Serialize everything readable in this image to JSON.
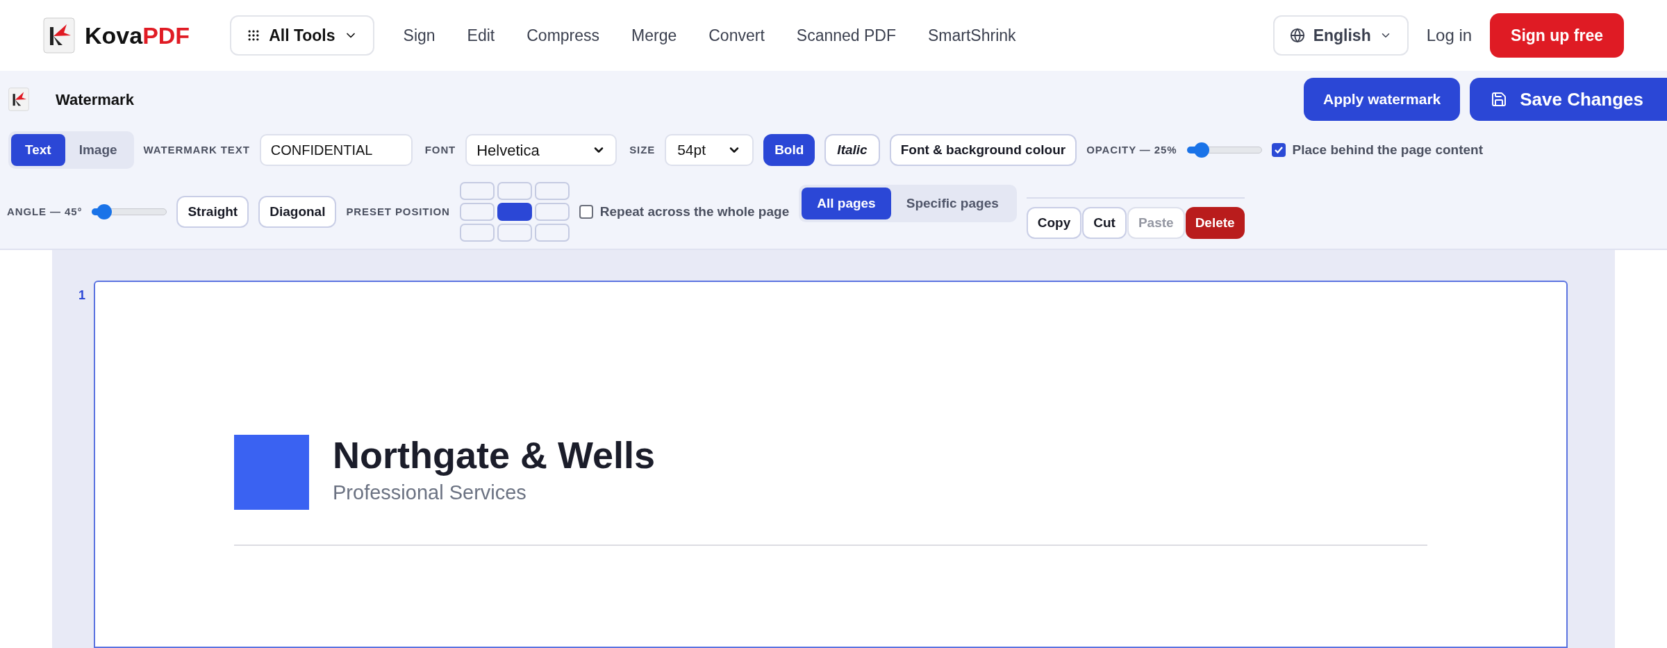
{
  "header": {
    "brand": {
      "part_1": "Kova",
      "part_2": "PDF"
    },
    "all_tools": "All Tools",
    "nav": [
      "Sign",
      "Edit",
      "Compress",
      "Merge",
      "Convert",
      "Scanned PDF",
      "SmartShrink"
    ],
    "language": "English",
    "login": "Log in",
    "signup": "Sign up free"
  },
  "toolbar": {
    "title": "Watermark",
    "apply": "Apply watermark",
    "save": "Save Changes",
    "modes": [
      {
        "label": "Text",
        "selected": true
      },
      {
        "label": "Image",
        "selected": false
      }
    ],
    "text_label": "WATERMARK TEXT",
    "text_value": "CONFIDENTIAL",
    "font_label": "FONT",
    "font_value": "Helvetica",
    "size_label": "SIZE",
    "size_value": "54pt",
    "styles": [
      {
        "label": "Bold",
        "kind": "bold",
        "on": true
      },
      {
        "label": "Italic",
        "kind": "italic",
        "on": false
      }
    ],
    "colour_button": "Font & background colour",
    "opacity": {
      "label": "OPACITY — 25%",
      "level": 0.15
    },
    "behind": {
      "label": "Place behind the page content",
      "checked": true
    },
    "angle": {
      "label": "ANGLE — 45°",
      "level": 0.12
    },
    "orientations": [
      "Straight",
      "Diagonal"
    ],
    "preset_label": "PRESET POSITION",
    "preset_cells": [
      {
        "selected": false
      },
      {
        "selected": false
      },
      {
        "selected": false
      },
      {
        "selected": false
      },
      {
        "selected": true
      },
      {
        "selected": false
      },
      {
        "selected": false
      },
      {
        "selected": false
      },
      {
        "selected": false
      }
    ],
    "repeat": {
      "label": "Repeat across the whole page",
      "checked": false
    },
    "pages": [
      {
        "label": "All pages",
        "selected": true
      },
      {
        "label": "Specific pages",
        "selected": false
      }
    ],
    "actions": [
      {
        "label": "Copy",
        "kind": "normal",
        "disabled": false
      },
      {
        "label": "Cut",
        "kind": "normal",
        "disabled": false
      },
      {
        "label": "Paste",
        "kind": "normal",
        "disabled": true
      },
      {
        "label": "Delete",
        "kind": "danger",
        "disabled": false
      }
    ]
  },
  "document": {
    "page_number": "1",
    "company": "Northgate & Wells",
    "tagline": "Professional Services"
  }
}
